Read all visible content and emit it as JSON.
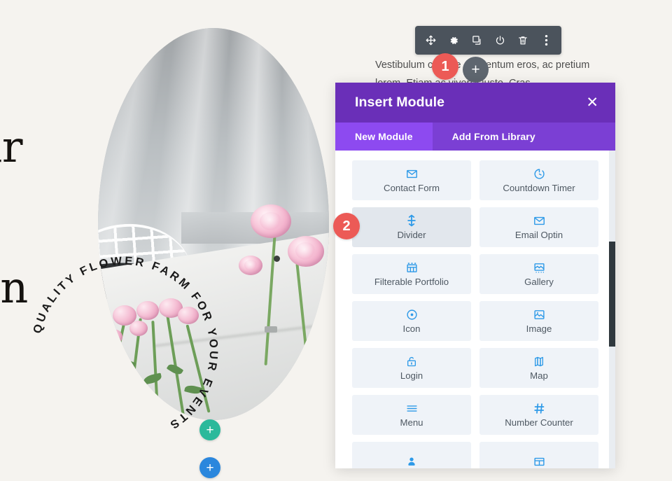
{
  "page": {
    "background_color": "#f5f3ef",
    "heading_fragments": [
      "ur",
      "on"
    ],
    "body_paragraph": "Vestibulum congue elementum eros, ac pretium lorem. Etiam ac viverra justo. Cras"
  },
  "photo_badge": {
    "circular_text": "QUALITY FLOWER FARM FOR YOUR EVENTS"
  },
  "builder": {
    "module_toolbar": {
      "buttons": [
        {
          "name": "move-icon",
          "title": "Move Module"
        },
        {
          "name": "gear-icon",
          "title": "Module Settings"
        },
        {
          "name": "duplicate-icon",
          "title": "Duplicate Module"
        },
        {
          "name": "power-icon",
          "title": "Disable Module"
        },
        {
          "name": "trash-icon",
          "title": "Delete Module"
        },
        {
          "name": "ellipsis-vertical-icon",
          "title": "More Options"
        }
      ]
    },
    "add_module_button_label": "+",
    "add_row_button_label": "+",
    "add_section_button_label": "+",
    "step_badges": [
      {
        "label": "1"
      },
      {
        "label": "2"
      }
    ],
    "accent_colors": {
      "toolbar": "#4b535c",
      "dark_plus": "#5e666f",
      "step_badge": "#ec5a56",
      "add_module_green": "#2bb99b",
      "add_row_blue": "#2b87dd"
    }
  },
  "modal": {
    "title": "Insert Module",
    "close_label": "✕",
    "header_color": "#6a2fb8",
    "tabs_color": "#7b3fd4",
    "active_tab_color": "#8d4af0",
    "tabs": [
      {
        "label": "New Module",
        "active": true
      },
      {
        "label": "Add From Library",
        "active": false
      }
    ],
    "tile_icon_color": "#2e9ae8",
    "tile_bg_color": "#eff3f8",
    "tile_hover_bg_color": "#e2e7ed",
    "modules": [
      {
        "label": "Contact Form",
        "icon": "envelope-icon",
        "hovered": false
      },
      {
        "label": "Countdown Timer",
        "icon": "clock-icon",
        "hovered": false
      },
      {
        "label": "Divider",
        "icon": "divider-icon",
        "hovered": true
      },
      {
        "label": "Email Optin",
        "icon": "envelope-icon",
        "hovered": false
      },
      {
        "label": "Filterable Portfolio",
        "icon": "grid-table-icon",
        "hovered": false
      },
      {
        "label": "Gallery",
        "icon": "gallery-icon",
        "hovered": false
      },
      {
        "label": "Icon",
        "icon": "target-dot-icon",
        "hovered": false
      },
      {
        "label": "Image",
        "icon": "picture-icon",
        "hovered": false
      },
      {
        "label": "Login",
        "icon": "lock-icon",
        "hovered": false
      },
      {
        "label": "Map",
        "icon": "map-icon",
        "hovered": false
      },
      {
        "label": "Menu",
        "icon": "hamburger-icon",
        "hovered": false
      },
      {
        "label": "Number Counter",
        "icon": "hash-icon",
        "hovered": false
      },
      {
        "label": "",
        "icon": "person-icon",
        "hovered": false
      },
      {
        "label": "",
        "icon": "table-grid-icon",
        "hovered": false
      }
    ]
  }
}
